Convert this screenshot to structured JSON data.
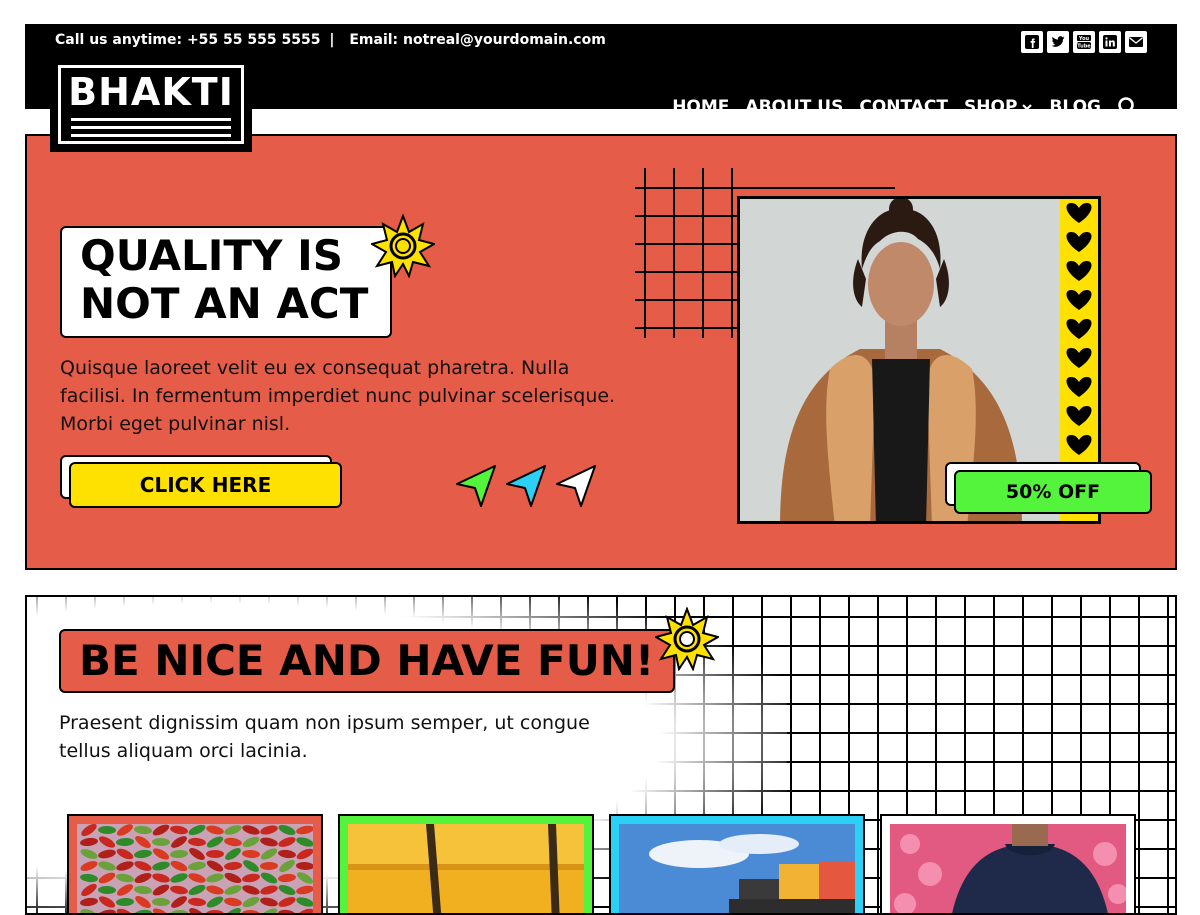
{
  "header": {
    "phone_text": "Call us anytime: +55 55 555 5555",
    "separator": "|",
    "email_text": "Email: notreal@yourdomain.com",
    "socials": [
      "facebook-icon",
      "twitter-icon",
      "youtube-icon",
      "linkedin-icon",
      "mail-icon"
    ],
    "logo": "BHAKTI",
    "nav": [
      {
        "label": "HOME"
      },
      {
        "label": "ABOUT US"
      },
      {
        "label": "CONTACT"
      },
      {
        "label": "SHOP"
      },
      {
        "label": "BLOG"
      }
    ]
  },
  "hero": {
    "title_line1": "QUALITY IS",
    "title_line2": "NOT AN ACT",
    "text": "Quisque laoreet velit eu ex consequat pharetra. Nulla facilisi. In fermentum imperdiet nunc pulvinar scelerisque. Morbi eget pulvinar nisl.",
    "cta_label": "CLICK HERE",
    "badge": "50% OFF"
  },
  "section2": {
    "title": "BE NICE AND HAVE FUN!",
    "text": "Praesent dignissim quam non ipsum semper, ut congue tellus aliquam orci lacinia."
  },
  "colors": {
    "brand_red": "#e55c49",
    "yellow": "#ffe100",
    "green": "#54f43c",
    "cyan": "#2ad0f5",
    "black": "#000000"
  }
}
